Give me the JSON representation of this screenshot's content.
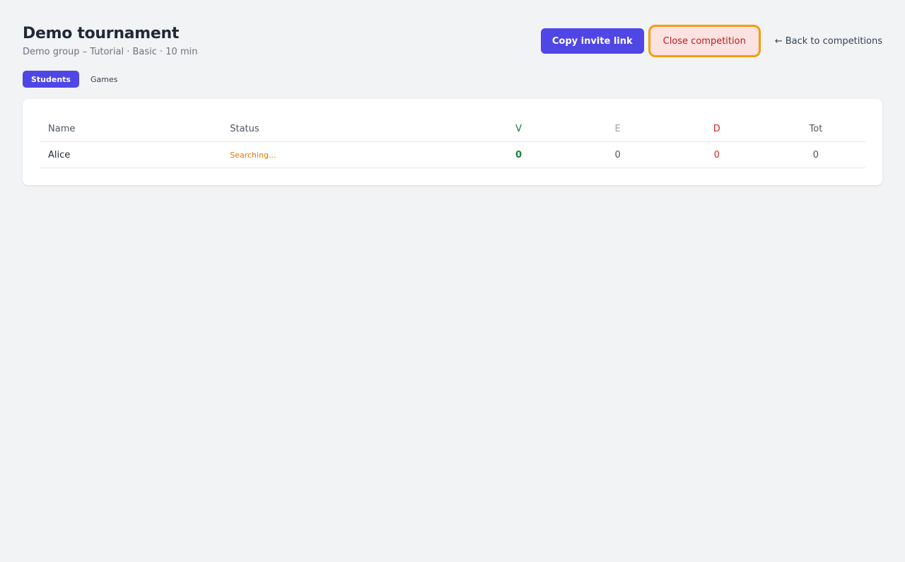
{
  "header": {
    "title": "Demo tournament",
    "subtitle": "Demo group – Tutorial · Basic · 10 min"
  },
  "actions": {
    "copy_invite_label": "Copy invite link",
    "close_competition_label": "Close competition",
    "back_arrow": "←",
    "back_label": "Back to competitions"
  },
  "tabs": [
    {
      "label": "Students",
      "active": true
    },
    {
      "label": "Games",
      "active": false
    }
  ],
  "table": {
    "columns": [
      "Name",
      "Status",
      "V",
      "E",
      "D",
      "Tot"
    ],
    "rows": [
      {
        "name": "Alice",
        "status": "Searching...",
        "v": "0",
        "e": "0",
        "d": "0",
        "tot": "0"
      }
    ]
  },
  "colors": {
    "accent": "#4f46e5",
    "win": "#15803d",
    "loss": "#dc2626",
    "searching": "#d97706",
    "focus_ring": "#f59e0b"
  }
}
